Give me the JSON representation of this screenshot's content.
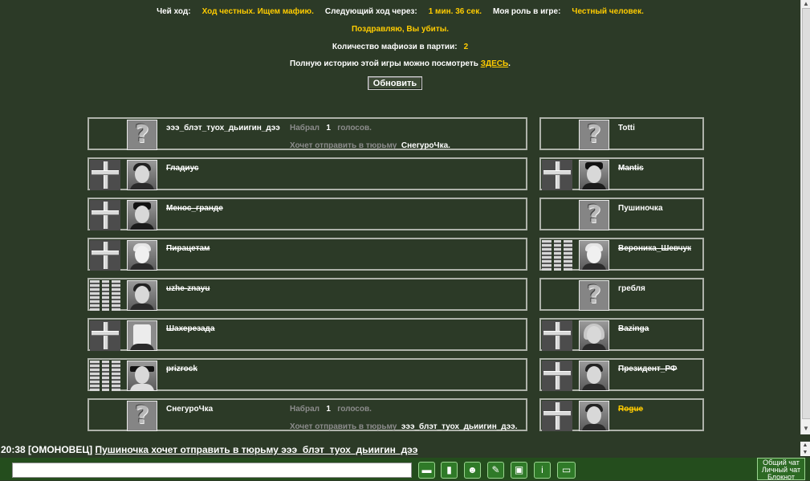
{
  "status": {
    "turn_label": "Чей ход:",
    "turn_value": "Ход честных. Ищем мафию.",
    "next_label": "Следующий ход через:",
    "next_value": "1 мин. 36 сек.",
    "role_label": "Моя роль в игре:",
    "role_value": "Честный человек.",
    "killed_msg": "Поздравляю, Вы убиты.",
    "mafia_label": "Количество мафиози в партии:",
    "mafia_count": "2",
    "history_text": "Полную историю этой игры можно посмотреть",
    "history_link": "ЗДЕСЬ",
    "history_end": ".",
    "refresh_label": "Обновить"
  },
  "votes": {
    "scored": "Набрал",
    "votes_word": "голосов.",
    "wants_jail": "Хочет отправить в тюрьму"
  },
  "players_left": [
    {
      "name": "эээ_блэт_туох_дьиигин_дээ",
      "votes": "1",
      "target": "СнегуроЧка."
    },
    {
      "name": "Гладиус"
    },
    {
      "name": "Менос_гранде"
    },
    {
      "name": "Пирацетам"
    },
    {
      "name": "uzhe-znayu"
    },
    {
      "name": "Шахерезада"
    },
    {
      "name": "prizrock"
    },
    {
      "name": "СнегуроЧка",
      "votes": "1",
      "target": "эээ_блэт_туох_дьиигин_дээ."
    }
  ],
  "players_right": [
    {
      "name": "Totti"
    },
    {
      "name": "Mantis"
    },
    {
      "name": "Пушиночка"
    },
    {
      "name": "Вероника_Шевчук"
    },
    {
      "name": "гребля"
    },
    {
      "name": "Bazinga"
    },
    {
      "name": "Президент_РФ"
    },
    {
      "name": "Rogue"
    }
  ],
  "log": {
    "prefix": "20:38 [ОМОНОВЕЦ]",
    "message": "Пушиночка хочет отправить в тюрьму эээ_блэт_туох_дьиигин_дээ"
  },
  "chat_tabs": {
    "general": "Общий чат",
    "private": "Личный чат",
    "notepad": "Блокнот"
  },
  "toolbar_icons": [
    "chat-bubble-icon",
    "phone-icon",
    "smiley-icon",
    "eraser-icon",
    "lock-icon",
    "info-icon",
    "screen-icon"
  ],
  "colors": {
    "background": "#2c3a27",
    "accent": "#ffcc00",
    "bottom_bar": "#244d1d"
  }
}
